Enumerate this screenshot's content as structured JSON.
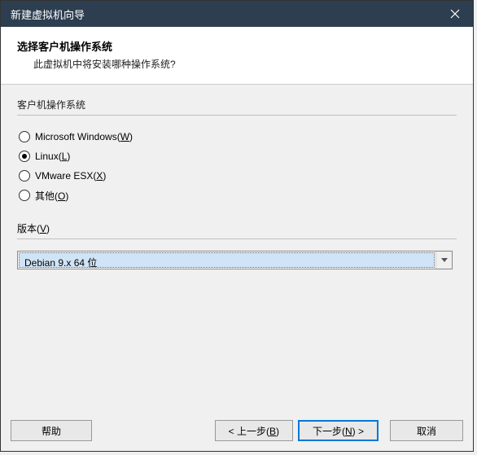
{
  "titlebar": {
    "text": "新建虚拟机向导"
  },
  "header": {
    "title": "选择客户机操作系统",
    "subtitle": "此虚拟机中将安装哪种操作系统?"
  },
  "os_group": {
    "label": "客户机操作系统",
    "options": [
      {
        "label": "Microsoft Windows(",
        "mnemonic": "W",
        "tail": ")"
      },
      {
        "label": "Linux(",
        "mnemonic": "L",
        "tail": ")"
      },
      {
        "label": "VMware ESX(",
        "mnemonic": "X",
        "tail": ")"
      },
      {
        "label": "其他(",
        "mnemonic": "O",
        "tail": ")"
      }
    ],
    "selected_index": 1
  },
  "version": {
    "label_prefix": "版本(",
    "label_mnemonic": "V",
    "label_suffix": ")",
    "selected": "Debian 9.x 64 位"
  },
  "buttons": {
    "help": "帮助",
    "back_prefix": "< 上一步(",
    "back_mnemonic": "B",
    "back_suffix": ")",
    "next_prefix": "下一步(",
    "next_mnemonic": "N",
    "next_suffix": ") >",
    "cancel": "取消"
  }
}
